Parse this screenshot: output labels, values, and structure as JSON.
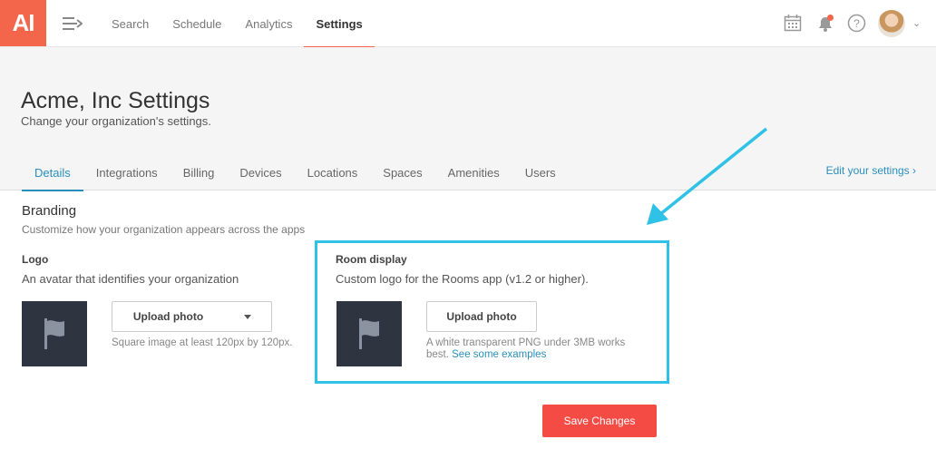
{
  "app": {
    "logo_text": "AI"
  },
  "nav": {
    "items": [
      "Search",
      "Schedule",
      "Analytics",
      "Settings"
    ],
    "active": "Settings"
  },
  "header": {
    "title": "Acme, Inc Settings",
    "subtitle": "Change your organization's settings.",
    "edit_link": "Edit your settings ›"
  },
  "tabs": [
    "Details",
    "Integrations",
    "Billing",
    "Devices",
    "Locations",
    "Spaces",
    "Amenities",
    "Users"
  ],
  "branding": {
    "title": "Branding",
    "subtitle": "Customize how your organization appears across the apps",
    "logo": {
      "title": "Logo",
      "description": "An avatar that identifies your organization",
      "upload_label": "Upload photo",
      "hint": "Square image at least 120px by 120px."
    },
    "room_display": {
      "title": "Room display",
      "description": "Custom logo for the Rooms app (v1.2 or higher).",
      "upload_label": "Upload photo",
      "hint_line1": "A white transparent PNG under 3MB works",
      "hint_line2": "best.",
      "hint_link": "See some examples"
    }
  },
  "save_label": "Save Changes",
  "colors": {
    "brand": "#f4664b",
    "link": "#2a8fbd",
    "highlight": "#2fc2e6",
    "save": "#f44b45"
  },
  "icons": [
    "menu-icon",
    "calendar-icon",
    "bell-icon",
    "help-icon",
    "flag-icon",
    "chevron-down-icon"
  ]
}
